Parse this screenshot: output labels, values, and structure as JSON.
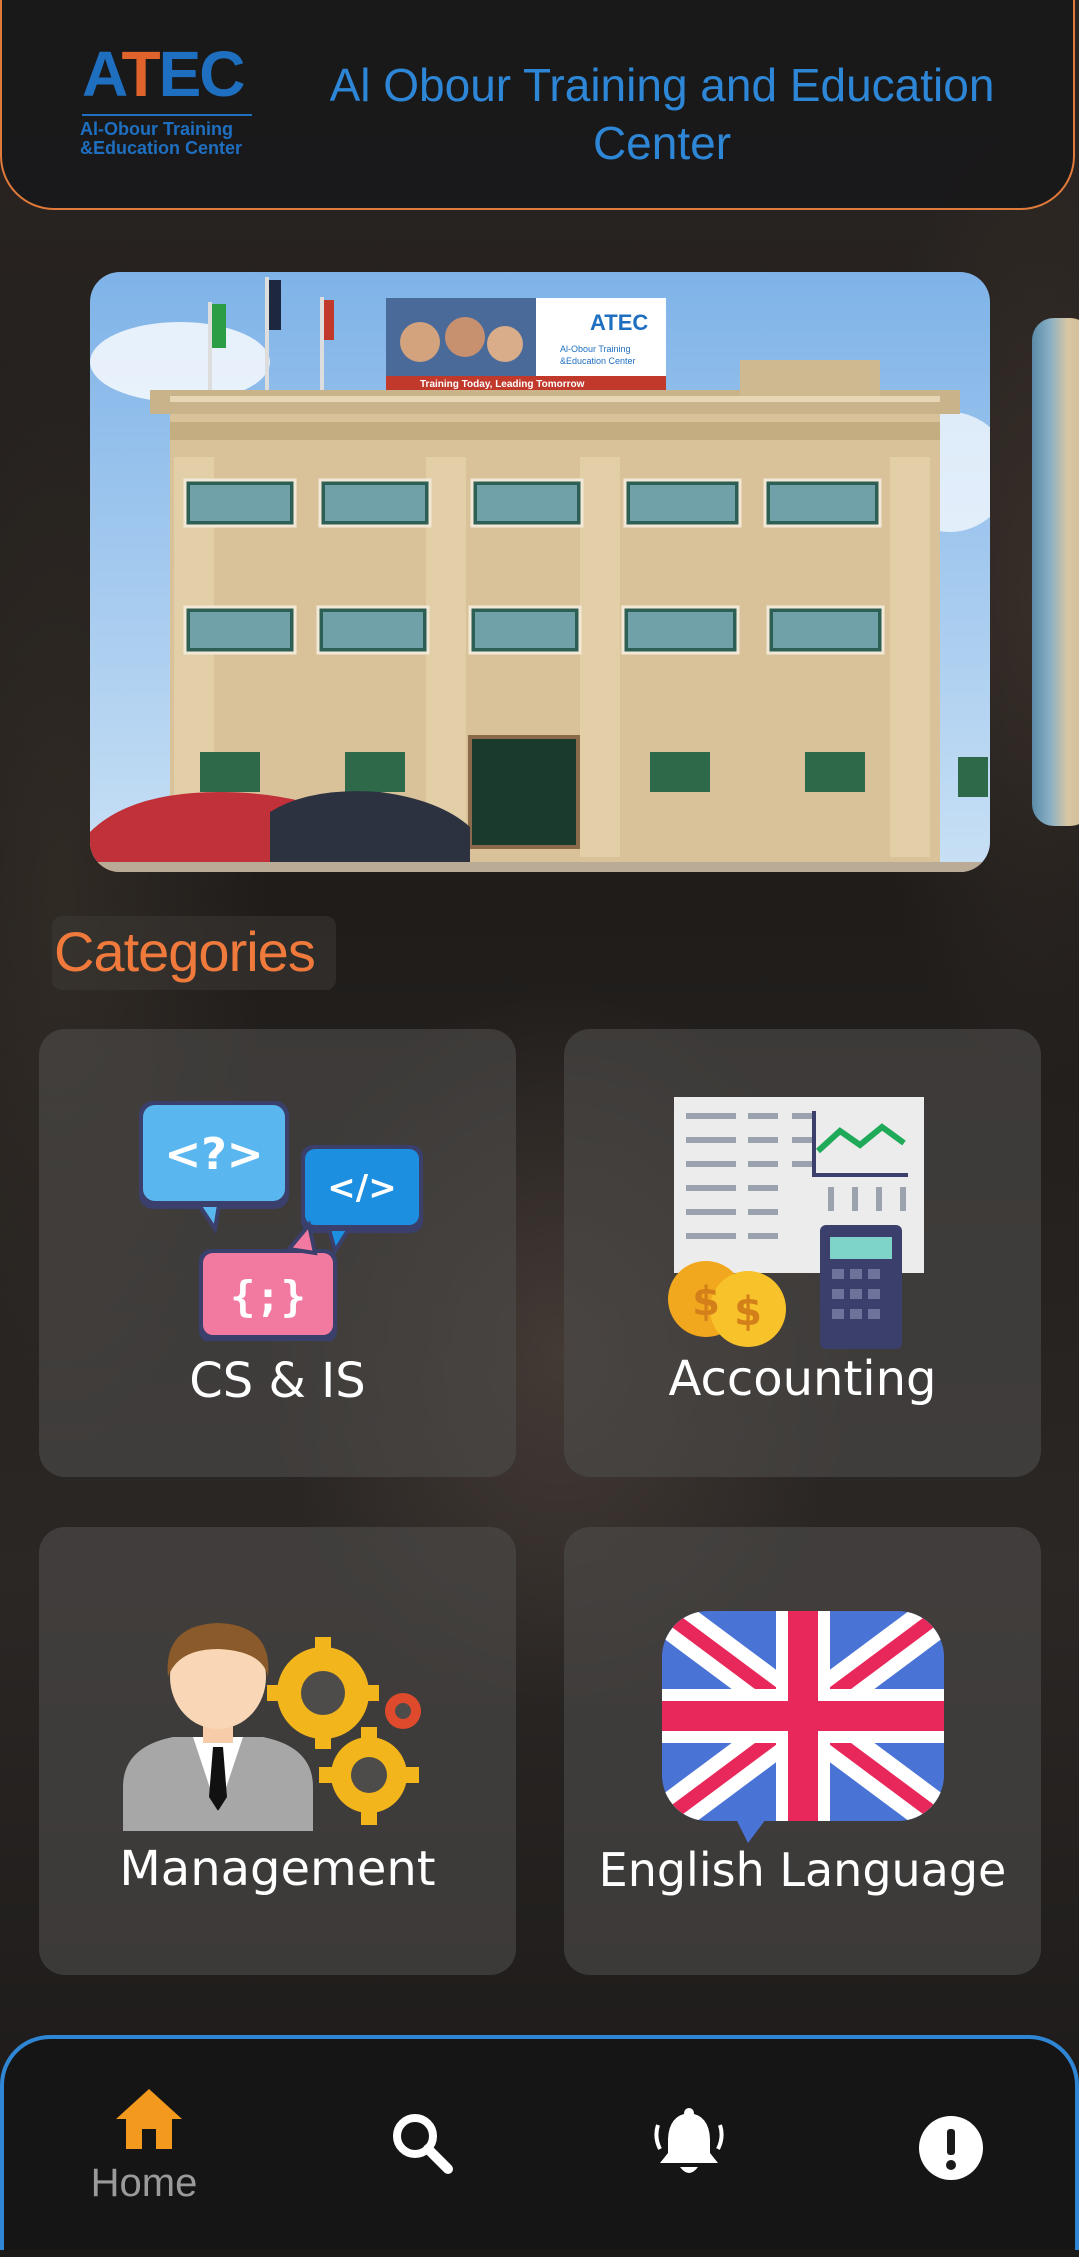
{
  "header": {
    "logo_mark": "ATEC",
    "logo_sub_line1": "Al-Obour Training",
    "logo_sub_line2": "&Education Center",
    "title": "Al Obour Training and Education Center"
  },
  "banner": {
    "sign_text_1": "Al-Obour Training",
    "sign_text_2": "&Education Center",
    "sign_slogan": "Training Today, Leading Tomorrow"
  },
  "categories": {
    "title": "Categories",
    "items": [
      {
        "label": "CS & IS",
        "icon": "code-bubbles-icon"
      },
      {
        "label": "Accounting",
        "icon": "accounting-calculator-icon"
      },
      {
        "label": "Management",
        "icon": "manager-gears-icon"
      },
      {
        "label": "English Language",
        "icon": "uk-flag-bubble-icon"
      }
    ]
  },
  "bottom_nav": {
    "items": [
      {
        "label": "Home",
        "icon": "home-icon",
        "active": true
      },
      {
        "label": "",
        "icon": "search-icon"
      },
      {
        "label": "",
        "icon": "bell-icon"
      },
      {
        "label": "",
        "icon": "info-exclamation-icon"
      }
    ],
    "active_color": "#f39a1e",
    "border_color": "#2f86d4"
  },
  "colors": {
    "accent_orange": "#ef7a3c",
    "title_blue": "#2e86d6"
  }
}
